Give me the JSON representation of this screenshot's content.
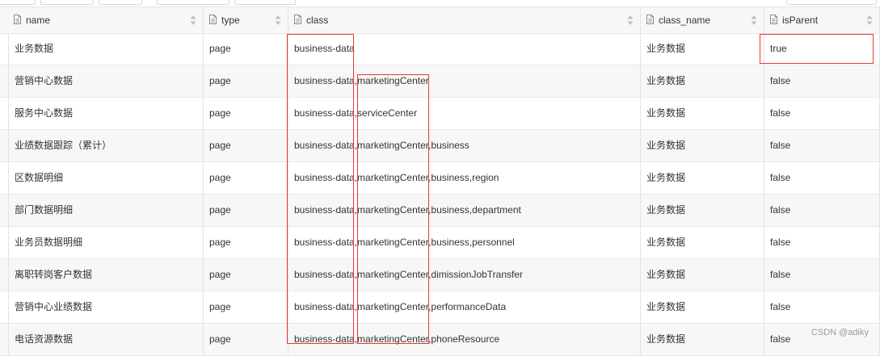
{
  "columns": [
    {
      "key": "name",
      "label": "name"
    },
    {
      "key": "type",
      "label": "type"
    },
    {
      "key": "class",
      "label": "class"
    },
    {
      "key": "class_name",
      "label": "class_name"
    },
    {
      "key": "isParent",
      "label": "isParent"
    }
  ],
  "rows": [
    {
      "name": "业务数据",
      "type": "page",
      "class": "business-data",
      "class_name": "业务数据",
      "isParent": "true"
    },
    {
      "name": "营销中心数据",
      "type": "page",
      "class": "business-data,marketingCenter",
      "class_name": "业务数据",
      "isParent": "false"
    },
    {
      "name": "服务中心数据",
      "type": "page",
      "class": "business-data,serviceCenter",
      "class_name": "业务数据",
      "isParent": "false"
    },
    {
      "name": "业绩数据跟踪（累计）",
      "type": "page",
      "class": "business-data,marketingCenter,business",
      "class_name": "业务数据",
      "isParent": "false"
    },
    {
      "name": "区数据明细",
      "type": "page",
      "class": "business-data,marketingCenter,business,region",
      "class_name": "业务数据",
      "isParent": "false"
    },
    {
      "name": "部门数据明细",
      "type": "page",
      "class": "business-data,marketingCenter,business,department",
      "class_name": "业务数据",
      "isParent": "false"
    },
    {
      "name": "业务员数据明细",
      "type": "page",
      "class": "business-data,marketingCenter,business,personnel",
      "class_name": "业务数据",
      "isParent": "false"
    },
    {
      "name": "离职转岗客户数据",
      "type": "page",
      "class": "business-data,marketingCenter,dimissionJobTransfer",
      "class_name": "业务数据",
      "isParent": "false"
    },
    {
      "name": "营销中心业绩数据",
      "type": "page",
      "class": "business-data,marketingCenter,performanceData",
      "class_name": "业务数据",
      "isParent": "false"
    },
    {
      "name": "电话资源数据",
      "type": "page",
      "class": "business-data,marketingCenter,phoneResource",
      "class_name": "业务数据",
      "isParent": "false"
    }
  ],
  "watermark": "CSDN @adiky",
  "colors": {
    "highlight": "#e53935",
    "header_bg": "#f7f7f7",
    "alt_row_bg": "#f7f7f7",
    "grid_line": "#e3e3e3"
  },
  "icons": {
    "column_header": "document-icon",
    "sort": "sort-arrows-icon"
  }
}
